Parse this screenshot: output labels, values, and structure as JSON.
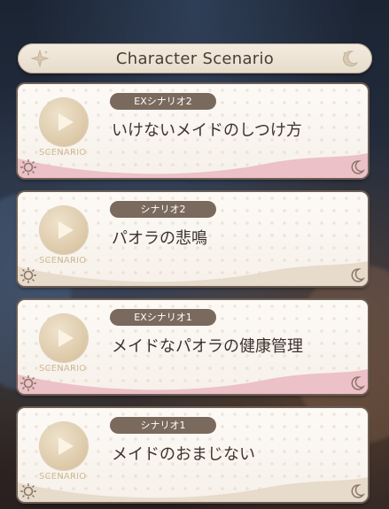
{
  "header": {
    "title": "Character Scenario",
    "icons": [
      "star-icon",
      "moon-icon"
    ]
  },
  "scenarios": [
    {
      "label": "EXシナリオ2",
      "title": "いけないメイドのしつけ方",
      "badge": "SCENARIO",
      "accent": "pink"
    },
    {
      "label": "シナリオ2",
      "title": "パオラの悲鳴",
      "badge": "SCENARIO",
      "accent": "beige"
    },
    {
      "label": "EXシナリオ1",
      "title": "メイドなパオラの健康管理",
      "badge": "SCENARIO",
      "accent": "pink"
    },
    {
      "label": "シナリオ1",
      "title": "メイドのおまじない",
      "badge": "SCENARIO",
      "accent": "beige"
    }
  ],
  "colors": {
    "pill": "#7a6a5e",
    "title_text": "#3d332d",
    "card_border": "#6d5e54",
    "pink_wave": "#eab8c2",
    "beige_wave": "#e4d7c6",
    "play_badge": "#dcc8a7"
  }
}
